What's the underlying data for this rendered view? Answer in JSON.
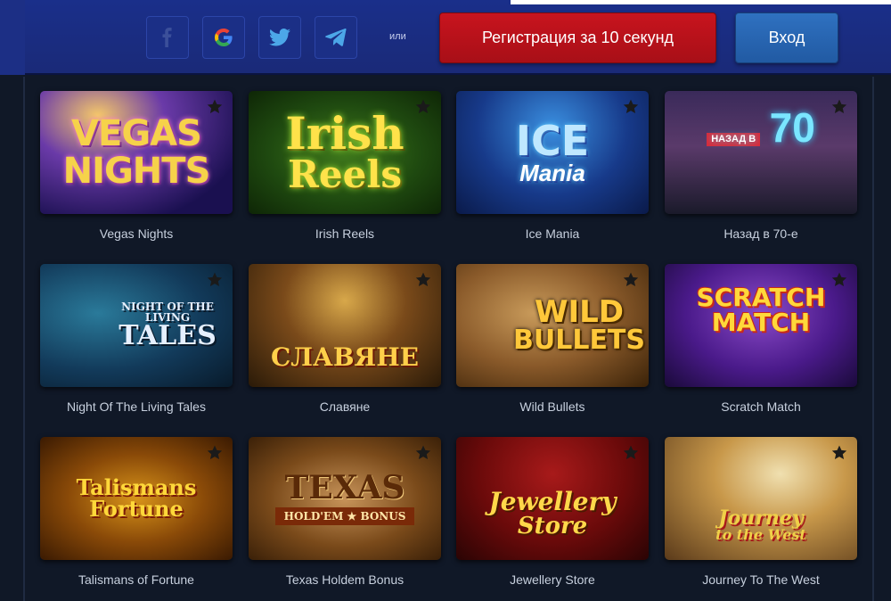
{
  "header": {
    "social": [
      {
        "name": "facebook",
        "icon": "facebook-icon"
      },
      {
        "name": "google",
        "icon": "google-icon"
      },
      {
        "name": "twitter",
        "icon": "twitter-icon"
      },
      {
        "name": "telegram",
        "icon": "telegram-icon"
      }
    ],
    "or_label": "или",
    "register_label": "Регистрация за 10 секунд",
    "login_label": "Вход"
  },
  "games": [
    {
      "title": "Vegas Nights",
      "logo_line1": "VEGAS",
      "logo_line2": "NIGHTS"
    },
    {
      "title": "Irish Reels",
      "logo_line1": "Irish",
      "logo_line2": "Reels"
    },
    {
      "title": "Ice Mania",
      "logo_line1": "ICE",
      "logo_line2": "Mania"
    },
    {
      "title": "Назад в 70-е",
      "logo_line1": "НАЗАД В",
      "logo_line2": "70"
    },
    {
      "title": "Night Of The Living Tales",
      "logo_line1": "NIGHT OF THE LIVING",
      "logo_line2": "TALES"
    },
    {
      "title": "Славяне",
      "logo_line1": "",
      "logo_line2": "СЛАВЯНЕ"
    },
    {
      "title": "Wild Bullets",
      "logo_line1": "WILD",
      "logo_line2": "BULLETS"
    },
    {
      "title": "Scratch Match",
      "logo_line1": "SCRATCH",
      "logo_line2": "MATCH"
    },
    {
      "title": "Talismans of Fortune",
      "logo_line1": "Talismans",
      "logo_line2": "Fortune"
    },
    {
      "title": "Texas Holdem Bonus",
      "logo_line1": "TEXAS",
      "logo_line2": "HOLD'EM ★ BONUS"
    },
    {
      "title": "Jewellery Store",
      "logo_line1": "Jewellery",
      "logo_line2": "Store"
    },
    {
      "title": "Journey To The West",
      "logo_line1": "Journey",
      "logo_line2": "to the West"
    }
  ],
  "colors": {
    "header_bg": "#1a2f8a",
    "page_bg": "#101827",
    "register_bg": "#c8141e",
    "login_bg": "#2f71c0"
  }
}
